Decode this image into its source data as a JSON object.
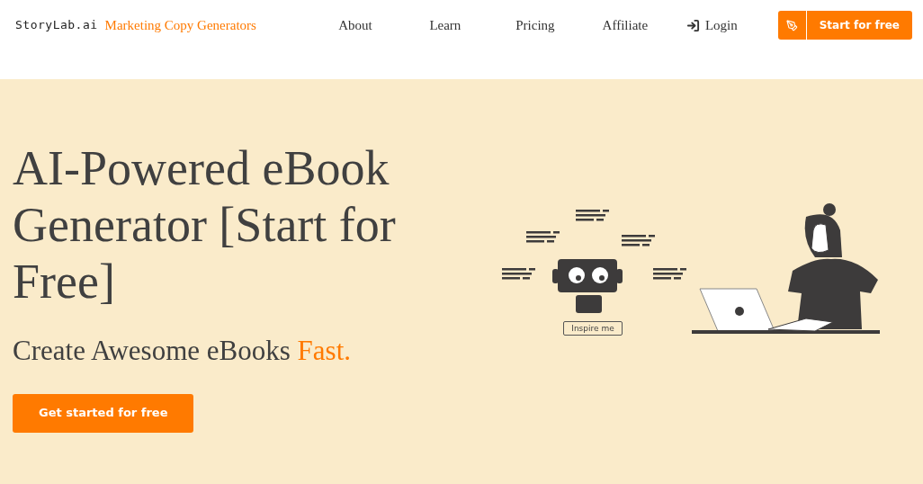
{
  "header": {
    "logo": "StoryLab.ai",
    "menu_link": "Marketing Copy Generators",
    "nav": [
      "About",
      "Learn",
      "Pricing",
      "Affiliate"
    ],
    "login": "Login",
    "cta": "Start for free"
  },
  "hero": {
    "title": "AI-Powered eBook Generator [Start for Free]",
    "subtitle": "Create Awesome eBooks",
    "subtitle_highlight": "Fast.",
    "button": "Get started for free",
    "illustration_button": "Inspire me"
  }
}
